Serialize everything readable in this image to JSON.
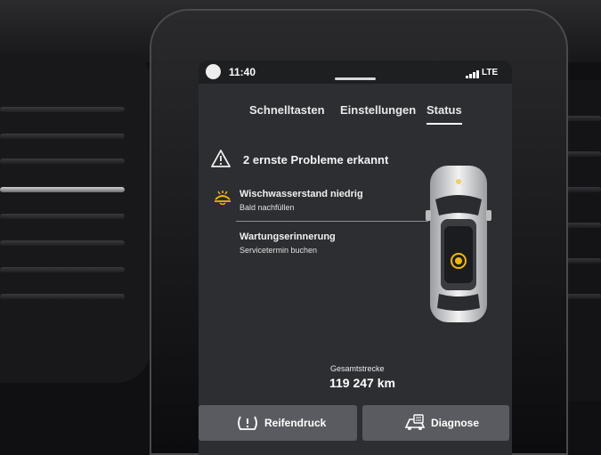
{
  "statusbar": {
    "time": "11:40",
    "network": "LTE"
  },
  "tabs": [
    {
      "label": "Schnelltasten",
      "active": false
    },
    {
      "label": "Einstellungen",
      "active": false
    },
    {
      "label": "Status",
      "active": true
    }
  ],
  "alert": {
    "summary": "2 ernste Probleme erkannt",
    "icon": "warning-triangle-icon"
  },
  "issues": [
    {
      "title": "Wischwasserstand niedrig",
      "subtitle": "Bald nachfüllen",
      "icon": "washer-fluid-icon",
      "icon_color": "#f5b800"
    },
    {
      "title": "Wartungserinnerung",
      "subtitle": "Servicetermin buchen",
      "icon": ""
    }
  ],
  "odometer": {
    "label": "Gesamtstrecke",
    "value": "119 247 km"
  },
  "buttons": {
    "tire_pressure": {
      "label": "Reifendruck",
      "icon": "tire-pressure-icon"
    },
    "diagnostics": {
      "label": "Diagnose",
      "icon": "diagnostics-icon"
    }
  },
  "colors": {
    "screen_bg": "#2c2e31",
    "accent_warning": "#f5b800",
    "button_bg": "#595b60"
  }
}
